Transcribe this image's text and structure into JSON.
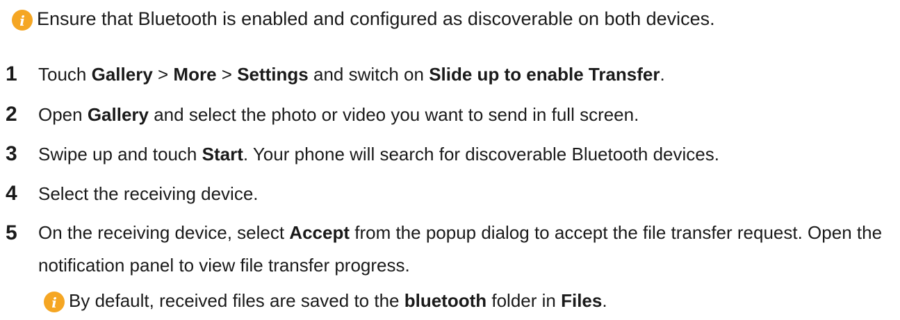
{
  "top_note": {
    "icon": "info-icon",
    "text": "Ensure that Bluetooth is enabled and configured as discoverable on both devices."
  },
  "steps": [
    {
      "number": "1",
      "parts": [
        "Touch ",
        "Gallery",
        " > ",
        "More",
        " > ",
        "Settings",
        " and switch on ",
        "Slide up to enable Transfer",
        "."
      ]
    },
    {
      "number": "2",
      "parts": [
        "Open ",
        "Gallery",
        " and select the photo or video you want to send in full screen."
      ]
    },
    {
      "number": "3",
      "parts": [
        "Swipe up and touch ",
        "Start",
        ". Your phone will search for discoverable Bluetooth devices."
      ]
    },
    {
      "number": "4",
      "parts": [
        "Select the receiving device."
      ]
    },
    {
      "number": "5",
      "parts": [
        "On the receiving device, select ",
        "Accept",
        " from the popup dialog to accept the file transfer request. Open the notification panel to view file transfer progress."
      ]
    }
  ],
  "sub_note": {
    "icon": "info-icon",
    "parts": [
      "By default, received files are saved to the ",
      "bluetooth",
      " folder in ",
      "Files",
      "."
    ]
  },
  "colors": {
    "icon_fill": "#f5a623",
    "text": "#1a1a1a"
  }
}
